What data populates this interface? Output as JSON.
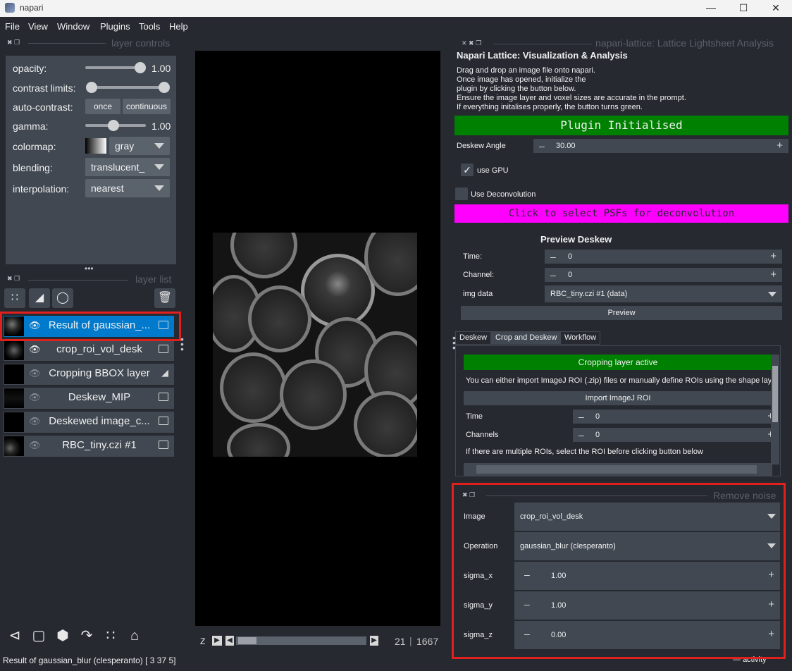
{
  "window": {
    "title": "napari"
  },
  "menu": [
    "File",
    "View",
    "Window",
    "Plugins",
    "Tools",
    "Help"
  ],
  "layer_controls": {
    "header": "layer controls",
    "opacity_label": "opacity:",
    "opacity_value": "1.00",
    "opacity_level": 1.0,
    "contrast_label": "contrast limits:",
    "autocontrast_label": "auto-contrast:",
    "once_label": "once",
    "continuous_label": "continuous",
    "gamma_label": "gamma:",
    "gamma_value": "1.00",
    "gamma_level": 0.5,
    "colormap_label": "colormap:",
    "colormap_value": "gray",
    "blending_label": "blending:",
    "blending_value": "translucent_",
    "interpolation_label": "interpolation:",
    "interpolation_value": "nearest"
  },
  "layer_list": {
    "header": "layer list",
    "layers": [
      {
        "name": "Result of gaussian_...",
        "visible": true,
        "type": "image",
        "selected": true
      },
      {
        "name": "crop_roi_vol_desk",
        "visible": true,
        "type": "image",
        "selected": false
      },
      {
        "name": "Cropping BBOX layer",
        "visible": false,
        "type": "shapes",
        "selected": false
      },
      {
        "name": "Deskew_MIP",
        "visible": false,
        "type": "image",
        "selected": false
      },
      {
        "name": "Deskewed image_c...",
        "visible": false,
        "type": "image",
        "selected": false
      },
      {
        "name": "RBC_tiny.czi #1",
        "visible": false,
        "type": "image",
        "selected": false
      }
    ]
  },
  "dims": {
    "axis": "Z",
    "current": "21",
    "total": "1667"
  },
  "status": "Result of gaussian_blur (clesperanto) [ 3 37  5]",
  "activity": "activity",
  "lattice": {
    "dock_title": "napari-lattice: Lattice Lightsheet Analysis",
    "title": "Napari Lattice: Visualization & Analysis",
    "instructions": [
      "Drag and drop an image file onto napari.",
      "Once image has opened, initialize the",
      "plugin by clicking the button below.",
      "Ensure the image layer and voxel sizes are accurate in the prompt.",
      " If everything initalises properly, the button turns green."
    ],
    "init_button": "Plugin Initialised",
    "deskew_angle_label": "Deskew Angle",
    "deskew_angle": "30.00",
    "use_gpu_label": "use GPU",
    "use_deconv_label": "Use Deconvolution",
    "psf_button": "Click to select PSFs for deconvolution",
    "preview_header": "Preview Deskew",
    "time_label": "Time:",
    "time_value": "0",
    "channel_label": "Channel:",
    "channel_value": "0",
    "imgdata_label": "img data",
    "imgdata_value": "RBC_tiny.czi #1 (data)",
    "preview_button": "Preview",
    "tabs": [
      "Deskew",
      "Crop and Deskew",
      "Workflow"
    ],
    "crop_active": "Cropping layer active",
    "crop_info": "You can either import ImageJ ROI (.zip) files or manually define ROIs using the shape layer",
    "import_roi": "Import ImageJ ROI",
    "crop_time_label": "Time",
    "crop_time_value": "0",
    "crop_channels_label": "Channels",
    "crop_channels_value": "0",
    "multi_roi_note": "If there are multiple ROIs, select the ROI before clicking button below"
  },
  "remove_noise": {
    "header": "Remove noise",
    "image_label": "Image",
    "image_value": "crop_roi_vol_desk",
    "operation_label": "Operation",
    "operation_value": "gaussian_blur (clesperanto)",
    "sigma_x_label": "sigma_x",
    "sigma_x": "1.00",
    "sigma_y_label": "sigma_y",
    "sigma_y": "1.00",
    "sigma_z_label": "sigma_z",
    "sigma_z": "0.00"
  },
  "icons": {
    "new_points": "points-icon",
    "new_shapes": "shapes-icon",
    "new_labels": "labels-icon",
    "delete": "trash-icon",
    "console": "console-icon",
    "ndisplay": "square-icon",
    "roll": "cube-icon",
    "transpose": "transpose-icon",
    "grid": "grid-icon",
    "home": "home-icon"
  },
  "colors": {
    "accent": "#007acc",
    "green": "#008000",
    "magenta": "#ff00ff",
    "highlight": "#e0201c"
  }
}
